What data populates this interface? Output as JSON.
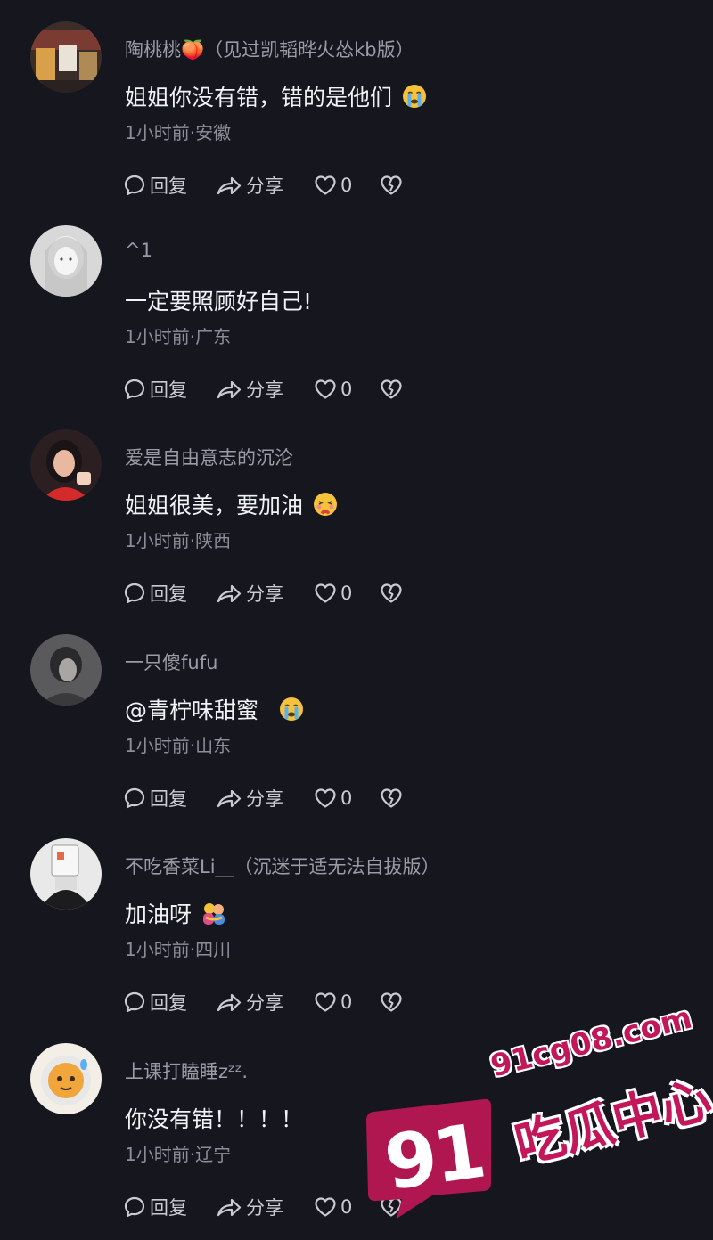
{
  "colors": {
    "background": "#16161e",
    "username": "#9a9ba6",
    "text": "#f1f2f6",
    "meta": "#8c8d98",
    "action": "#c9cad2",
    "watermark": "#c2185b"
  },
  "comments": [
    {
      "username": "陶桃桃🍑（见过凯韬晔火怂kb版）",
      "text": "姐姐你没有错，错的是他们",
      "emoji": "crying-face-emoji",
      "meta": "1小时前·安徽",
      "reply_label": "回复",
      "share_label": "分享",
      "likes": "0"
    },
    {
      "username": "^1",
      "text": "一定要照顾好自己!",
      "emoji": "",
      "meta": "1小时前·广东",
      "reply_label": "回复",
      "share_label": "分享",
      "likes": "0"
    },
    {
      "username": "爱是自由意志的沉沦",
      "text": "姐姐很美，要加油",
      "emoji": "blushing-heart-emoji",
      "meta": "1小时前·陕西",
      "reply_label": "回复",
      "share_label": "分享",
      "likes": "0"
    },
    {
      "username": "一只傻fufu",
      "text": "@青柠味甜蜜",
      "emoji": "crying-face-emoji",
      "meta": "1小时前·山东",
      "reply_label": "回复",
      "share_label": "分享",
      "likes": "0"
    },
    {
      "username": "不吃香菜Li__（沉迷于适无法自拔版）",
      "text": "加油呀",
      "emoji": "hug-emoji",
      "meta": "1小时前·四川",
      "reply_label": "回复",
      "share_label": "分享",
      "likes": "0"
    },
    {
      "username": "上课打瞌睡zᶻᶻ.",
      "text": "你没有错！！！！",
      "emoji": "",
      "meta": "1小时前·辽宁",
      "reply_label": "回复",
      "share_label": "分享",
      "likes": "0"
    }
  ],
  "watermark": {
    "number": "91",
    "url": "91cg08.com",
    "name": "吃瓜中心"
  }
}
